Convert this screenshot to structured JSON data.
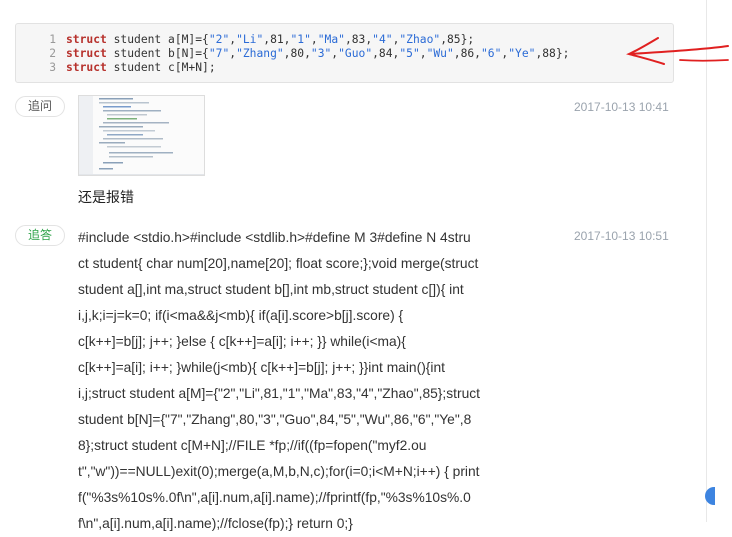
{
  "code_block": {
    "lines": [
      {
        "num": "1",
        "keyword": "struct",
        "text": " student a[M]={\"2\",\"Li\",81,\"1\",\"Ma\",83,\"4\",\"Zhao\",85};"
      },
      {
        "num": "2",
        "keyword": "struct",
        "text": " student b[N]={\"7\",\"Zhang\",80,\"3\",\"Guo\",84,\"5\",\"Wu\",86,\"6\",\"Ye\",88};"
      },
      {
        "num": "3",
        "keyword": "struct",
        "text": " student c[M+N];"
      }
    ]
  },
  "annotation": {
    "arrow_color": "#e02020",
    "icon": "hand-drawn-arrow"
  },
  "followup": {
    "tag": "追问",
    "timestamp": "2017-10-13 10:41",
    "text": "还是报错",
    "thumbnail_icon": "code-screenshot-thumbnail"
  },
  "reply": {
    "tag": "追答",
    "timestamp": "2017-10-13 10:51",
    "lines": [
      "#include <stdio.h>#include <stdlib.h>#define M 3#define N 4stru",
      "ct student{ char num[20],name[20]; float score;};void merge(struct",
      "student a[],int ma,struct student b[],int mb,struct student c[]){ int",
      "i,j,k;i=j=k=0; if(i<ma&&j<mb){ if(a[i].score>b[j].score) {",
      "c[k++]=b[j]; j++; }else { c[k++]=a[i]; i++; }} while(i<ma){",
      "c[k++]=a[i]; i++; }while(j<mb){ c[k++]=b[j]; j++; }}int main(){int",
      "i,j;struct student a[M]={\"2\",\"Li\",81,\"1\",\"Ma\",83,\"4\",\"Zhao\",85};struct",
      "student b[N]={\"7\",\"Zhang\",80,\"3\",\"Guo\",84,\"5\",\"Wu\",86,\"6\",\"Ye\",8",
      "8};struct student c[M+N];//FILE *fp;//if((fp=fopen(\"myf2.ou",
      "t\",\"w\"))==NULL)exit(0);merge(a,M,b,N,c);for(i=0;i<M+N;i++) { print",
      "f(\"%3s%10s%.0f\\n\",a[i].num,a[i].name);//fprintf(fp,\"%3s%10s%.0",
      "f\\n\",a[i].num,a[i].name);//fclose(fp);} return 0;}"
    ]
  },
  "colors": {
    "accent_green": "#2fa34a",
    "timestamp_gray": "#9aa3ad",
    "scroll_blue": "#3d84e0"
  }
}
